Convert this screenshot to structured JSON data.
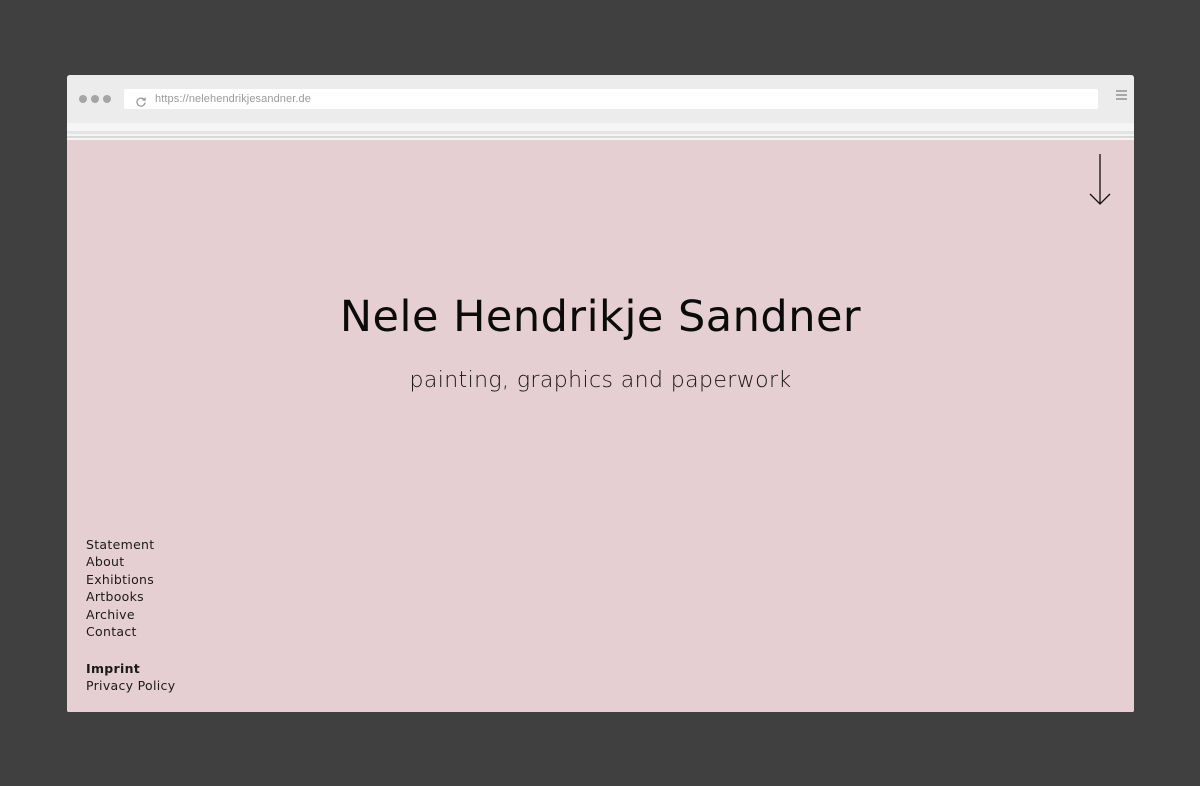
{
  "browser": {
    "url": "https://nelehendrikjesandner.de"
  },
  "site": {
    "title": "Nele Hendrikje Sandner",
    "subtitle": "painting, graphics and paperwork",
    "background_color": "#e6cfd2"
  },
  "nav": {
    "items": [
      {
        "label": "Statement"
      },
      {
        "label": "About"
      },
      {
        "label": "Exhibtions"
      },
      {
        "label": "Artbooks"
      },
      {
        "label": "Archive"
      },
      {
        "label": "Contact"
      }
    ]
  },
  "legal": {
    "items": [
      {
        "label": "Imprint",
        "active": true
      },
      {
        "label": "Privacy Policy",
        "active": false
      }
    ]
  }
}
